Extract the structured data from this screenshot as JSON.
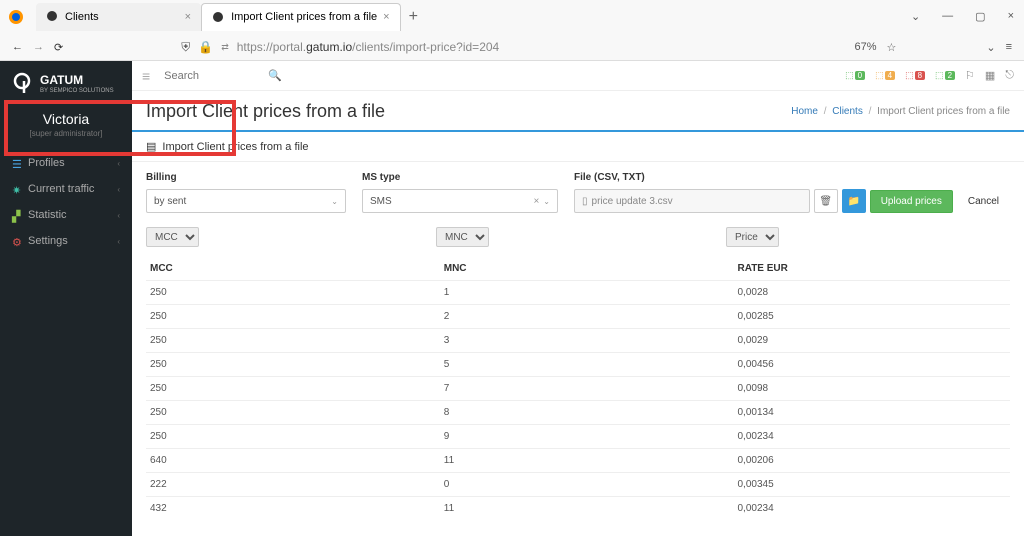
{
  "browser": {
    "tabs": [
      {
        "title": "Clients",
        "active": false
      },
      {
        "title": "Import Client prices from a file",
        "active": true
      }
    ],
    "url_pre": "https://portal.",
    "url_host": "gatum.io",
    "url_path": "/clients/import-price?id=204",
    "zoom": "67%"
  },
  "brand": {
    "name": "GATUM",
    "sub": "BY SEMPICO SOLUTIONS"
  },
  "user": {
    "name": "Victoria",
    "role": "[super administrator]"
  },
  "nav": {
    "profiles": "Profiles",
    "traffic": "Current traffic",
    "statistic": "Statistic",
    "settings": "Settings"
  },
  "topbar": {
    "search_placeholder": "Search",
    "badges": [
      {
        "count": "0",
        "class": "green"
      },
      {
        "count": "4",
        "class": "orange"
      },
      {
        "count": "8",
        "class": "red"
      },
      {
        "count": "2",
        "class": "green"
      }
    ]
  },
  "page": {
    "title": "Import Client prices from a file",
    "bc_home": "Home",
    "bc_clients": "Clients",
    "bc_current": "Import Client prices from a file",
    "panel_title": "Import Client prices from a file"
  },
  "form": {
    "billing_label": "Billing",
    "billing_value": "by sent",
    "sms_label": "MS type",
    "sms_value": "SMS",
    "file_label": "File (CSV, TXT)",
    "file_value": "price update 3.csv",
    "upload_btn": "Upload prices",
    "cancel_btn": "Cancel"
  },
  "mapping": {
    "c1": "MCC",
    "c2": "MNC",
    "c3": "Price"
  },
  "table": {
    "headers": {
      "c1": "MCC",
      "c2": "MNC",
      "c3": "RATE EUR"
    },
    "rows": [
      {
        "mcc": "250",
        "mnc": "1",
        "rate": "0,0028"
      },
      {
        "mcc": "250",
        "mnc": "2",
        "rate": "0,00285"
      },
      {
        "mcc": "250",
        "mnc": "3",
        "rate": "0,0029"
      },
      {
        "mcc": "250",
        "mnc": "5",
        "rate": "0,00456"
      },
      {
        "mcc": "250",
        "mnc": "7",
        "rate": "0,0098"
      },
      {
        "mcc": "250",
        "mnc": "8",
        "rate": "0,00134"
      },
      {
        "mcc": "250",
        "mnc": "9",
        "rate": "0,00234"
      },
      {
        "mcc": "640",
        "mnc": "11",
        "rate": "0,00206"
      },
      {
        "mcc": "222",
        "mnc": "0",
        "rate": "0,00345"
      },
      {
        "mcc": "432",
        "mnc": "11",
        "rate": "0,00234"
      }
    ]
  }
}
